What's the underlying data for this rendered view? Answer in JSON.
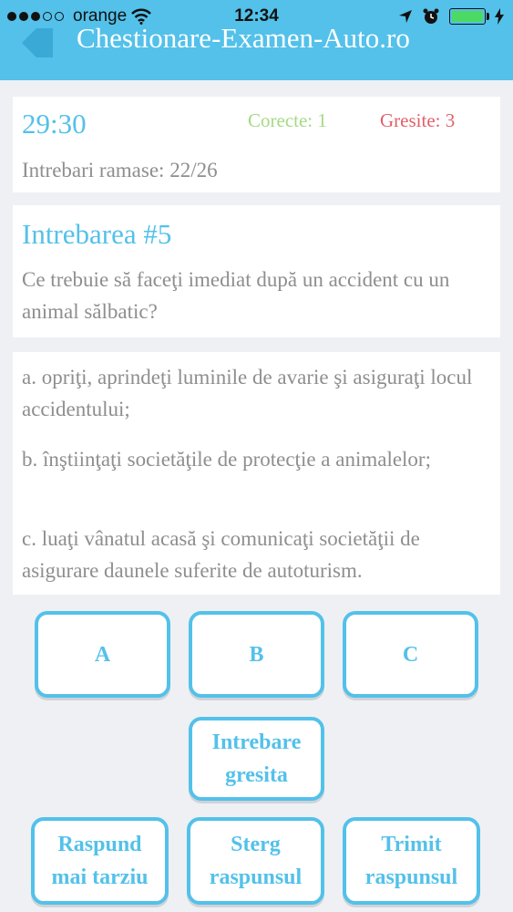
{
  "status_bar": {
    "carrier": "orange",
    "time": "12:34"
  },
  "header": {
    "title": "Chestionare-Examen-Auto.ro",
    "back_icon": "back-arrow-icon",
    "background_color": "#53c1ea"
  },
  "stats": {
    "timer": "29:30",
    "correct": "Corecte: 1",
    "wrong": "Gresite: 3",
    "remaining": "Intrebari ramase: 22/26"
  },
  "question": {
    "title": "Intrebarea #5",
    "text": "Ce trebuie să faceţi imediat după un accident cu un animal sălbatic?"
  },
  "answers": [
    {
      "text": "a. opriţi, aprindeţi luminile de avarie şi asiguraţi locul accidentului;"
    },
    {
      "text": "b. înştiinţaţi societăţile de protecţie a animalelor;"
    },
    {
      "text": "c. luaţi vânatul acasă şi comunicaţi societăţii de asigurare daunele suferite de autoturism."
    }
  ],
  "buttons": {
    "a": "A",
    "b": "B",
    "c": "C",
    "wrong_question_line1": "Intrebare",
    "wrong_question_line2": "gresita",
    "later_line1": "Raspund",
    "later_line2": "mai tarziu",
    "clear_line1": "Sterg",
    "clear_line2": "raspunsul",
    "send_line1": "Trimit",
    "send_line2": "raspunsul"
  },
  "colors": {
    "accent": "#53c1ea",
    "correct": "#a6d985",
    "wrong": "#e0606a",
    "text_muted": "#8e8e8e"
  }
}
